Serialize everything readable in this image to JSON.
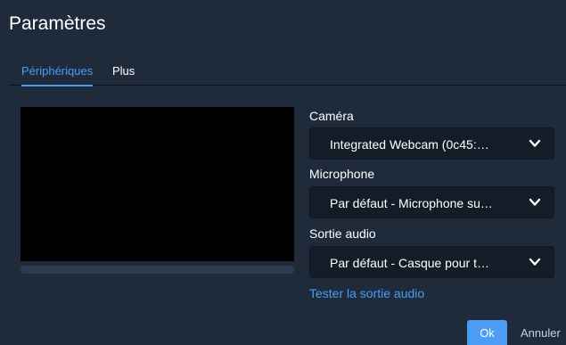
{
  "dialog": {
    "title": "Paramètres"
  },
  "tabs": [
    {
      "label": "Périphériques",
      "active": true
    },
    {
      "label": "Plus",
      "active": false
    }
  ],
  "preview": {
    "audio_level": 0
  },
  "camera": {
    "label": "Caméra",
    "selected": "Integrated Webcam (0c45:…"
  },
  "microphone": {
    "label": "Microphone",
    "selected": "Par défaut - Microphone su…"
  },
  "audio_output": {
    "label": "Sortie audio",
    "selected": "Par défaut - Casque pour t…"
  },
  "test_audio_link": "Tester la sortie audio",
  "buttons": {
    "ok": "Ok",
    "cancel": "Annuler"
  },
  "colors": {
    "background": "#1f2b3b",
    "accent": "#4a9cf7",
    "select_bg": "#131c27",
    "video_bg": "#000000"
  },
  "icons": {
    "select_chevron": "chevron-down-icon"
  }
}
